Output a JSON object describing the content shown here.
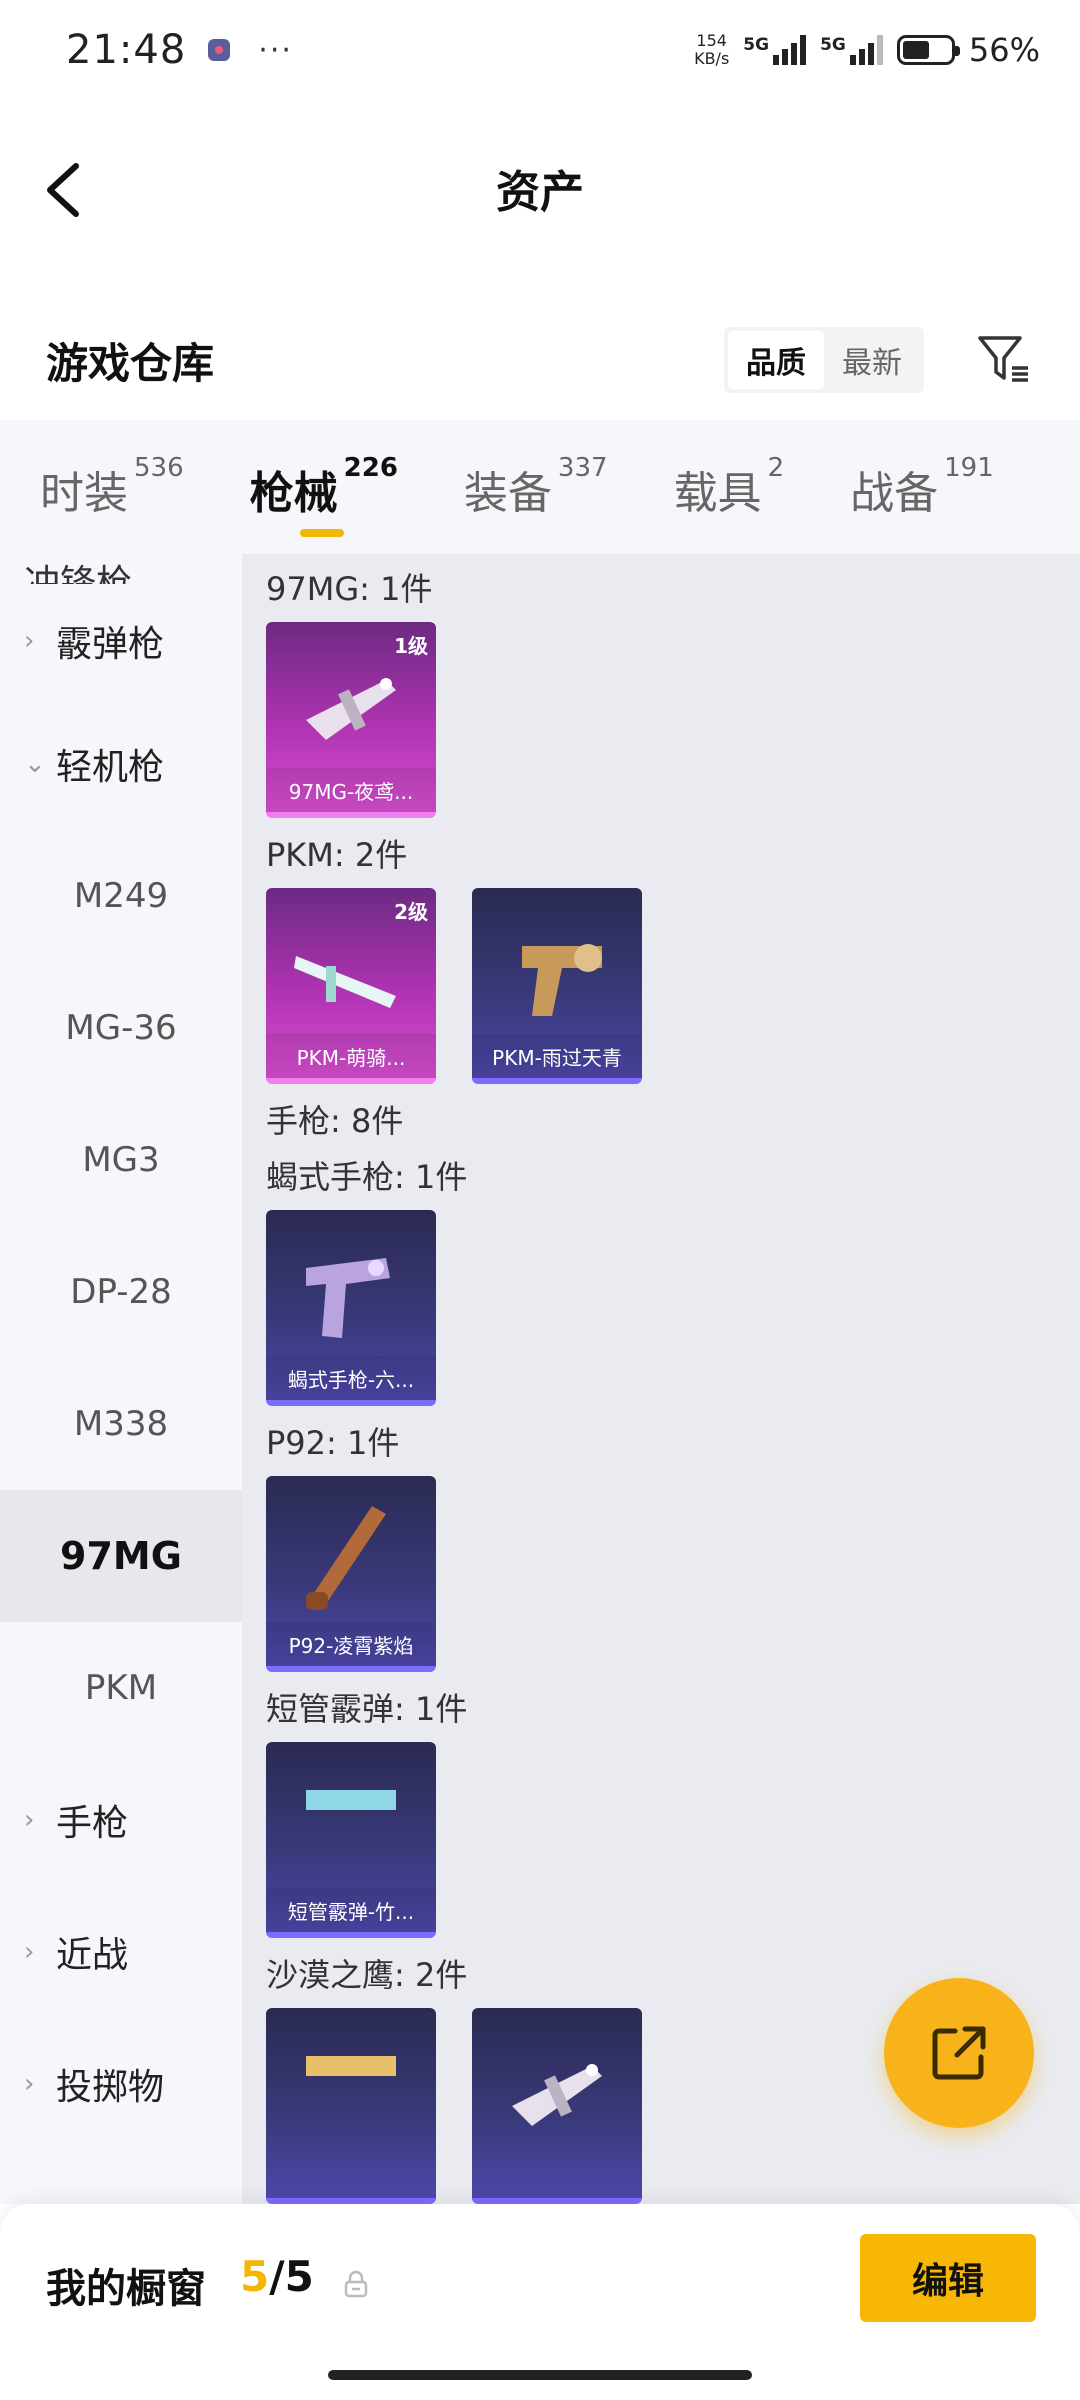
{
  "status_bar": {
    "time": "21:48",
    "speed_value": "154",
    "speed_unit": "KB/s",
    "net1": "5G",
    "net2": "5G",
    "battery_pct": "56%",
    "battery_level": 0.56
  },
  "header": {
    "title": "资产"
  },
  "section": {
    "title": "游戏仓库",
    "sort_options": [
      "品质",
      "最新"
    ],
    "sort_selected": "品质"
  },
  "tabs": [
    {
      "label": "时装",
      "count": "536"
    },
    {
      "label": "枪械",
      "count": "226"
    },
    {
      "label": "装备",
      "count": "337"
    },
    {
      "label": "载具",
      "count": "2"
    },
    {
      "label": "战备",
      "count": "191"
    }
  ],
  "active_tab": "枪械",
  "sidebar": {
    "partial_top": "冲锋枪",
    "items": [
      {
        "label": "霰弹枪",
        "type": "group",
        "chevron": "›"
      },
      {
        "label": "轻机枪",
        "type": "group",
        "chevron": "⌄"
      },
      {
        "label": "M249",
        "type": "sub"
      },
      {
        "label": "MG-36",
        "type": "sub"
      },
      {
        "label": "MG3",
        "type": "sub"
      },
      {
        "label": "DP-28",
        "type": "sub"
      },
      {
        "label": "M338",
        "type": "sub"
      },
      {
        "label": "97MG",
        "type": "sub",
        "active": true
      },
      {
        "label": "PKM",
        "type": "sub"
      },
      {
        "label": "手枪",
        "type": "group",
        "chevron": "›"
      },
      {
        "label": "近战",
        "type": "group",
        "chevron": "›"
      },
      {
        "label": "投掷物",
        "type": "group",
        "chevron": "›"
      }
    ]
  },
  "content": {
    "groups": [
      {
        "label": "97MG: 1件",
        "cards": [
          {
            "name": "97MG-夜鸢...",
            "level": "1级",
            "rarity": "purple"
          }
        ]
      },
      {
        "label": "PKM: 2件",
        "cards": [
          {
            "name": "PKM-萌骑...",
            "level": "2级",
            "rarity": "purple"
          },
          {
            "name": "PKM-雨过天青",
            "level": "",
            "rarity": "blue"
          }
        ]
      },
      {
        "label": "手枪: 8件",
        "cards": []
      },
      {
        "label": "蝎式手枪: 1件",
        "cards": [
          {
            "name": "蝎式手枪-六...",
            "level": "",
            "rarity": "blue"
          }
        ]
      },
      {
        "label": "P92: 1件",
        "cards": [
          {
            "name": "P92-凌霄紫焰",
            "level": "",
            "rarity": "blue"
          }
        ]
      },
      {
        "label": "短管霰弹: 1件",
        "cards": [
          {
            "name": "短管霰弹-竹...",
            "level": "",
            "rarity": "blue"
          }
        ]
      },
      {
        "label": "沙漠之鹰: 2件",
        "cards": [
          {
            "name": "",
            "level": "",
            "rarity": "blue"
          },
          {
            "name": "",
            "level": "",
            "rarity": "blue"
          }
        ]
      }
    ]
  },
  "bottom_bar": {
    "label": "我的橱窗",
    "current": "5",
    "separator": "/",
    "total": "5",
    "edit_label": "编辑"
  },
  "colors": {
    "accent": "#f2b705",
    "fab": "#f8b31a",
    "purple_card": "#b033b2",
    "blue_card": "#3a3a7c"
  },
  "icons": {
    "back": "chevron-left-icon",
    "filter": "filter-icon",
    "share": "share-external-icon",
    "lock": "lock-icon"
  }
}
